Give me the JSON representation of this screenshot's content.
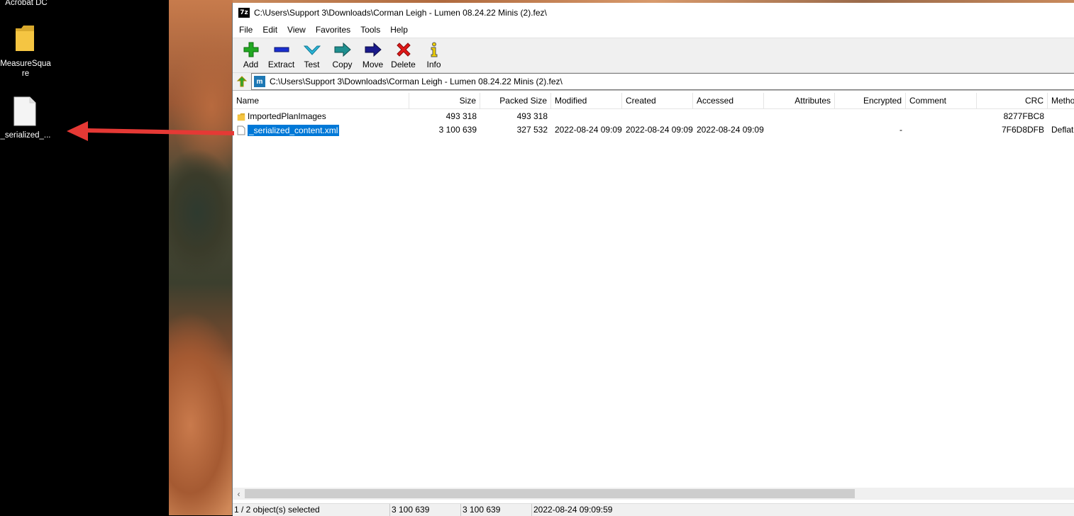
{
  "desktop": {
    "top_label": "Acrobat DC",
    "icons": [
      {
        "label_line1": "MeasureSqua",
        "label_line2": "re",
        "icon": "folder-icon"
      },
      {
        "label": "_serialized_...",
        "icon": "file-icon"
      }
    ]
  },
  "window": {
    "title": "C:\\Users\\Support 3\\Downloads\\Corman Leigh - Lumen 08.24.22 Minis (2).fez\\",
    "app_icon_text": "7z",
    "menu": [
      "File",
      "Edit",
      "View",
      "Favorites",
      "Tools",
      "Help"
    ],
    "toolbar": [
      {
        "label": "Add",
        "icon": "plus-icon",
        "color": "#1fa51f"
      },
      {
        "label": "Extract",
        "icon": "minus-icon",
        "color": "#1a2fd0"
      },
      {
        "label": "Test",
        "icon": "checkmark-icon",
        "color": "#2bb5d8"
      },
      {
        "label": "Copy",
        "icon": "copy-arrow-icon",
        "color": "#1f8f8f"
      },
      {
        "label": "Move",
        "icon": "move-arrow-icon",
        "color": "#1a1a8c"
      },
      {
        "label": "Delete",
        "icon": "delete-x-icon",
        "color": "#e01818"
      },
      {
        "label": "Info",
        "icon": "info-icon",
        "color": "#f0d000"
      }
    ],
    "address": {
      "icon_text": "m",
      "path": "C:\\Users\\Support 3\\Downloads\\Corman Leigh - Lumen 08.24.22 Minis (2).fez\\"
    },
    "columns": [
      "Name",
      "Size",
      "Packed Size",
      "Modified",
      "Created",
      "Accessed",
      "Attributes",
      "Encrypted",
      "Comment",
      "CRC",
      "Metho"
    ],
    "rows": [
      {
        "name": "ImportedPlanImages",
        "type": "folder",
        "size": "493 318",
        "packed": "493 318",
        "modified": "",
        "created": "",
        "accessed": "",
        "attributes": "",
        "encrypted": "",
        "comment": "",
        "crc": "8277FBC8",
        "method": ""
      },
      {
        "name": "_serialized_content.xml",
        "type": "file",
        "size": "3 100 639",
        "packed": "327 532",
        "modified": "2022-08-24 09:09",
        "created": "2022-08-24 09:09",
        "accessed": "2022-08-24 09:09",
        "attributes": "",
        "encrypted": "-",
        "comment": "",
        "crc": "7F6D8DFB",
        "method": "Deflat",
        "selected": true
      }
    ],
    "status": [
      "1 / 2 object(s) selected",
      "3 100 639",
      "3 100 639",
      "2022-08-24 09:09:59"
    ]
  },
  "colors": {
    "selection": "#0078d7",
    "arrow": "#e53935",
    "folder": "#f5c542"
  }
}
